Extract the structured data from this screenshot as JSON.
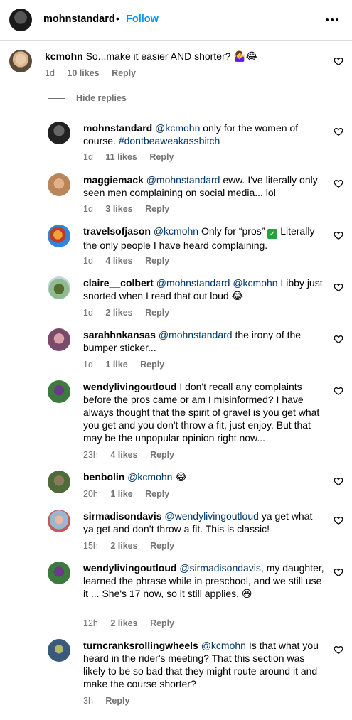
{
  "header": {
    "username": "mohnstandard",
    "separator": "•",
    "follow_label": "Follow"
  },
  "top_comment": {
    "username": "kcmohn",
    "text": "So...make it easier AND shorter? 🤷‍♀️😂",
    "time": "1d",
    "likes": "10 likes",
    "reply": "Reply"
  },
  "hide_replies_label": "Hide replies",
  "replies": [
    {
      "username": "mohnstandard",
      "mention": "@kcmohn",
      "text": " only for the women of course. ",
      "tag": "#dontbeaweakassbitch",
      "time": "1d",
      "likes": "11 likes",
      "reply": "Reply"
    },
    {
      "username": "maggiemack",
      "mention": "@mohnstandard",
      "text": " eww. I've literally only seen men complaining on social media... lol",
      "time": "1d",
      "likes": "3 likes",
      "reply": "Reply"
    },
    {
      "username": "travelsofjason",
      "mention": "@kcmohn",
      "text": " Only for “pros” ",
      "text2": " Literally the only people I have heard complaining.",
      "time": "1d",
      "likes": "4 likes",
      "reply": "Reply"
    },
    {
      "username": "claire__colbert",
      "mention": "@mohnstandard",
      "mention2": "@kcmohn",
      "text": " Libby just snorted when I read that out loud 😂",
      "time": "1d",
      "likes": "2 likes",
      "reply": "Reply"
    },
    {
      "username": "sarahhnkansas",
      "mention": "@mohnstandard",
      "text": " the irony of the bumper sticker...",
      "time": "1d",
      "likes": "1 like",
      "reply": "Reply"
    },
    {
      "username": "wendylivingoutloud",
      "text": " I don't recall any complaints before the pros came or am I misinformed? I have always thought that the spirit of gravel is you get what you get and you don't throw a fit, just enjoy. But that may be the unpopular opinion right now...",
      "time": "23h",
      "likes": "4 likes",
      "reply": "Reply"
    },
    {
      "username": "benbolin",
      "mention": "@kcmohn",
      "text": " 😂",
      "time": "20h",
      "likes": "1 like",
      "reply": "Reply"
    },
    {
      "username": "sirmadisondavis",
      "mention": "@wendylivingoutloud",
      "text": " ya get what ya get and don’t throw a fit. This is classic!",
      "time": "15h",
      "likes": "2 likes",
      "reply": "Reply"
    },
    {
      "username": "wendylivingoutloud",
      "mention": "@sirmadisondavis",
      "text": ", my daughter, learned the phrase while in preschool, and we still use it ... She's 17 now, so it still applies, 😆",
      "time": "12h",
      "likes": "2 likes",
      "reply": "Reply"
    },
    {
      "username": "turncranksrollingwheels",
      "mention": "@kcmohn",
      "text": " Is that what you heard in the rider's meeting? That this section was likely to be so bad that they might route around it and make the course shorter?",
      "time": "3h",
      "reply": "Reply"
    }
  ],
  "colors": {
    "link": "#0095f6",
    "mention": "#00376b",
    "meta": "#737373"
  }
}
